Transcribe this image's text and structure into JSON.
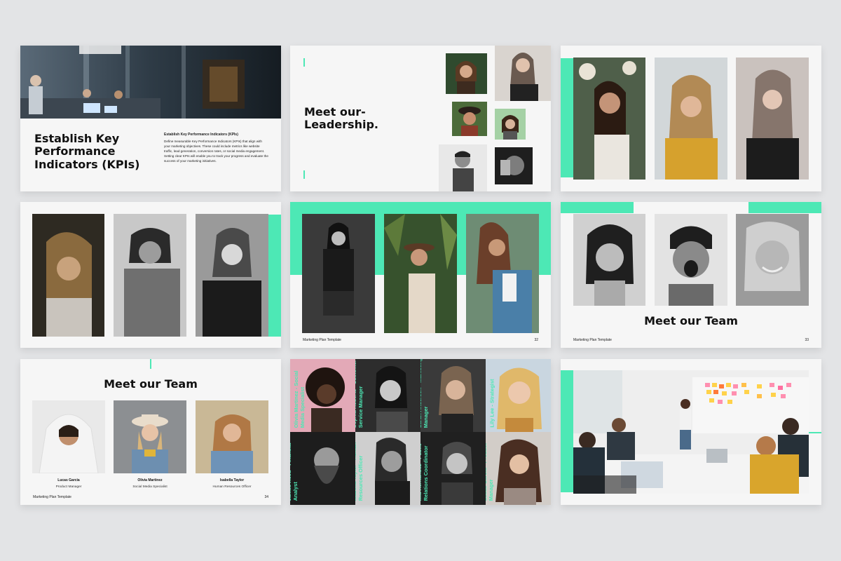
{
  "slides": {
    "kpi": {
      "title": "Establish Key Performance Indicators (KPIs)",
      "subtitle": "Establish Key Performance Indicators (KPIs)",
      "body": "Define measurable Key Performance Indicators (KPIs) that align with your marketing objectives. These could include metrics like website traffic, lead generation, conversion rates, or social media engagement. Setting clear KPIs will enable you to track your progress and evaluate the success of your marketing initiatives."
    },
    "leadership": {
      "title": "Meet our- Leadership."
    },
    "team_bw": {
      "title": "Meet our Team",
      "footer": "Marketing Plan Template",
      "page": "33"
    },
    "gallery_teal": {
      "footer": "Marketing Plan Template",
      "page": "32"
    },
    "team_three": {
      "title": "Meet our Team",
      "footer": "Marketing Plan Template",
      "page": "34",
      "members": [
        {
          "name": "Lucas Garcia",
          "role": "Product Manager"
        },
        {
          "name": "Olivia Martinez",
          "role": "Social Media Specialist"
        },
        {
          "name": "Isabella Taylor",
          "role": "Human Resources Officer"
        }
      ]
    },
    "team_grid": {
      "members": [
        "Olivia Martinez - Social Media Specialist",
        "Sophia Roberts - Customer Service Manager",
        "Sarah Anderson - Marketing Manager",
        "Lily Lee - Strategist",
        "James Reed - Financial Analyst",
        "Isabella Taylor - Human Resources Officer",
        "Mia Hernandez - Public Relations Coordinator",
        "Lucas Garcia - Product Manager"
      ]
    }
  },
  "colors": {
    "accent": "#4de8b5",
    "background": "#e3e4e6",
    "slide": "#f6f6f6"
  }
}
